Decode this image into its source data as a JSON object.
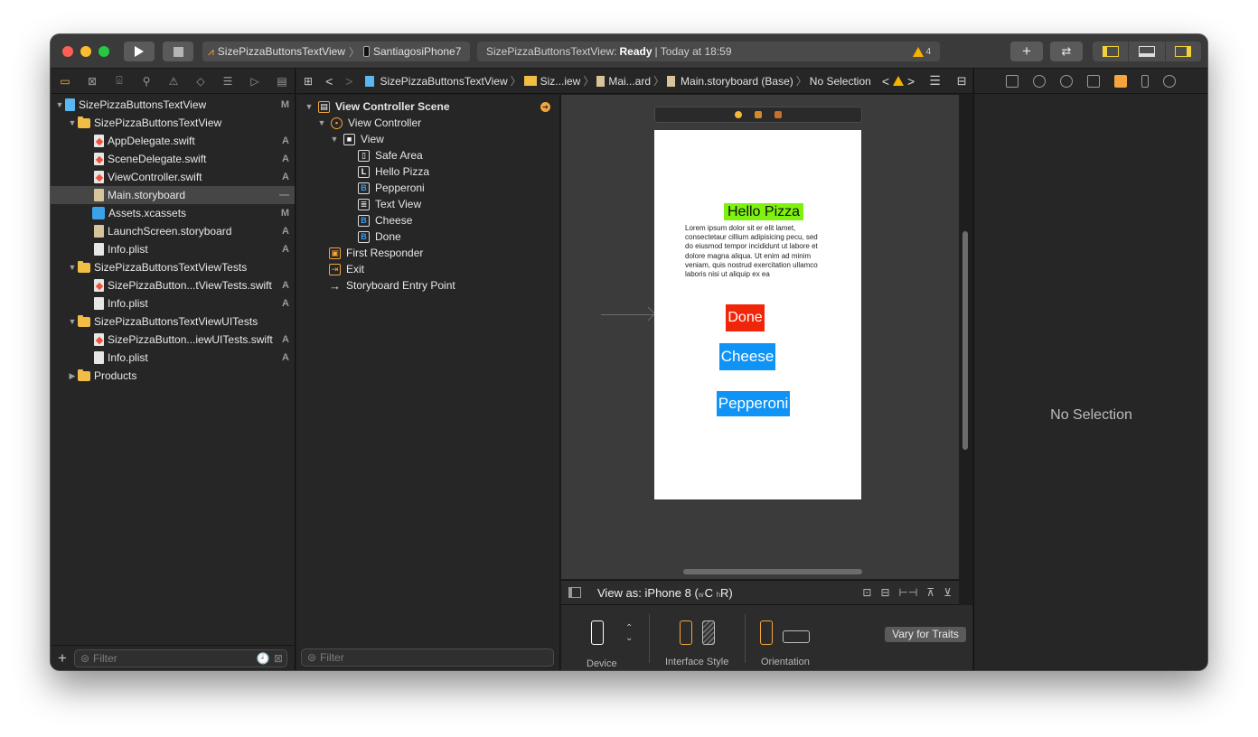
{
  "toolbar": {
    "scheme": "SizePizzaButtonsTextView",
    "device": "SantiagosiPhone7",
    "activity_project": "SizePizzaButtonsTextView:",
    "activity_status": "Ready",
    "activity_time": "| Today at 18:59",
    "warning_count": "4"
  },
  "navigator": {
    "tree": [
      {
        "label": "SizePizzaButtonsTextView",
        "status": "M"
      },
      {
        "label": "SizePizzaButtonsTextView",
        "status": ""
      },
      {
        "label": "AppDelegate.swift",
        "status": "A"
      },
      {
        "label": "SceneDelegate.swift",
        "status": "A"
      },
      {
        "label": "ViewController.swift",
        "status": "A"
      },
      {
        "label": "Main.storyboard",
        "status": "—"
      },
      {
        "label": "Assets.xcassets",
        "status": "M"
      },
      {
        "label": "LaunchScreen.storyboard",
        "status": "A"
      },
      {
        "label": "Info.plist",
        "status": "A"
      },
      {
        "label": "SizePizzaButtonsTextViewTests",
        "status": ""
      },
      {
        "label": "SizePizzaButton...tViewTests.swift",
        "status": "A"
      },
      {
        "label": "Info.plist",
        "status": "A"
      },
      {
        "label": "SizePizzaButtonsTextViewUITests",
        "status": ""
      },
      {
        "label": "SizePizzaButton...iewUITests.swift",
        "status": "A"
      },
      {
        "label": "Info.plist",
        "status": "A"
      },
      {
        "label": "Products",
        "status": ""
      }
    ],
    "filter_placeholder": "Filter"
  },
  "jumpbar": {
    "crumbs": [
      "SizePizzaButtonsTextView",
      "Siz...iew",
      "Mai...ard",
      "Main.storyboard (Base)",
      "No Selection"
    ]
  },
  "outline": {
    "scene": "View Controller Scene",
    "items": [
      "View Controller",
      "View",
      "Safe Area",
      "Hello Pizza",
      "Pepperoni",
      "Text View",
      "Cheese",
      "Done",
      "First Responder",
      "Exit",
      "Storyboard Entry Point"
    ],
    "filter_placeholder": "Filter"
  },
  "canvas": {
    "hello_label": "Hello Pizza",
    "lorem": "Lorem ipsum dolor sit er elit lamet, consectetaur cillium adipisicing pecu, sed do eiusmod tempor incididunt ut labore et dolore magna aliqua. Ut enim ad minim veniam, quis nostrud exercitation ullamco laboris nisi ut aliquip ex ea",
    "done_label": "Done",
    "cheese_label": "Cheese",
    "pepperoni_label": "Pepperoni"
  },
  "view_as": {
    "prefix": "View as: iPhone 8 (",
    "w": "w",
    "c": "C",
    "h": "h",
    "r": "R",
    "suffix": ")"
  },
  "traits": {
    "device_label": "Device",
    "interface_style_label": "Interface Style",
    "orientation_label": "Orientation",
    "vary_button": "Vary for Traits"
  },
  "inspector": {
    "empty_text": "No Selection"
  }
}
